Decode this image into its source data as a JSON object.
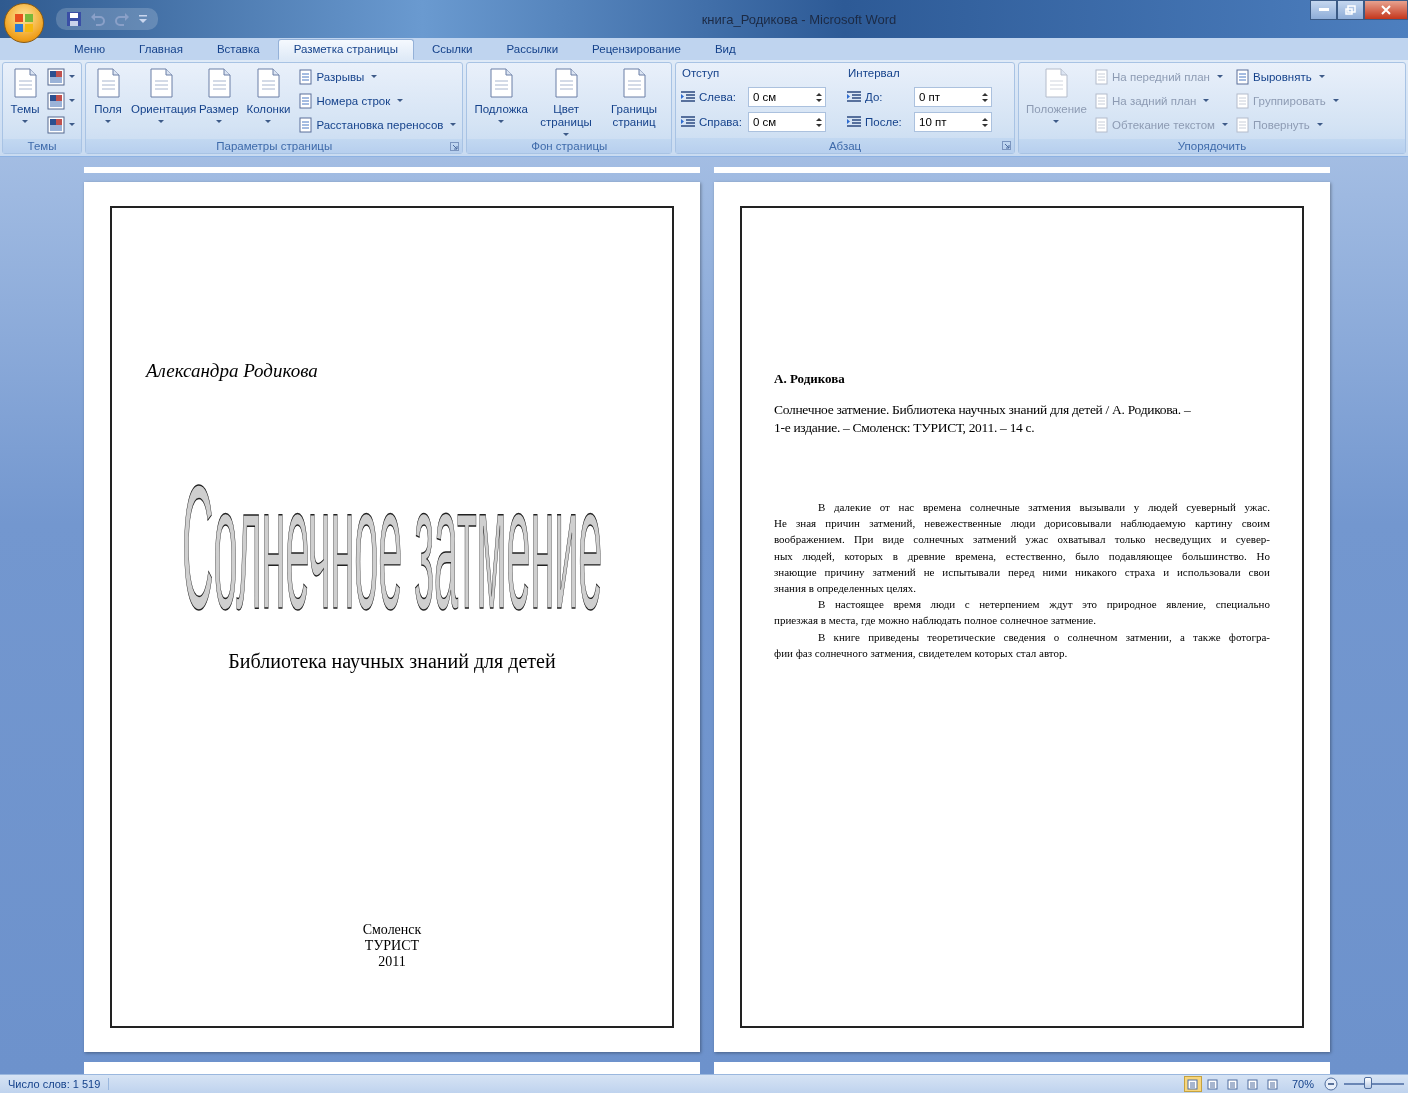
{
  "window": {
    "title": "книга_Родикова - Microsoft Word"
  },
  "tabs": [
    {
      "label": "Меню",
      "selected": false
    },
    {
      "label": "Главная",
      "selected": false
    },
    {
      "label": "Вставка",
      "selected": false
    },
    {
      "label": "Разметка страницы",
      "selected": true
    },
    {
      "label": "Ссылки",
      "selected": false
    },
    {
      "label": "Рассылки",
      "selected": false
    },
    {
      "label": "Рецензирование",
      "selected": false
    },
    {
      "label": "Вид",
      "selected": false
    }
  ],
  "ribbon": [
    {
      "label": "Темы",
      "launcher": false,
      "columns": [
        [
          {
            "kind": "large",
            "label": "Темы",
            "dropdown": true,
            "disabled": false
          }
        ],
        [
          {
            "kind": "icon",
            "dropdown": true,
            "disabled": false
          },
          {
            "kind": "icon",
            "dropdown": true,
            "disabled": false
          },
          {
            "kind": "icon",
            "dropdown": true,
            "disabled": false
          }
        ]
      ]
    },
    {
      "label": "Параметры страницы",
      "launcher": true,
      "columns": [
        [
          {
            "kind": "large",
            "label": "Поля",
            "dropdown": true,
            "disabled": false
          }
        ],
        [
          {
            "kind": "large",
            "label": "Ориентация",
            "dropdown": true,
            "disabled": false
          }
        ],
        [
          {
            "kind": "large",
            "label": "Размер",
            "dropdown": true,
            "disabled": false
          }
        ],
        [
          {
            "kind": "large",
            "label": "Колонки",
            "dropdown": true,
            "disabled": false
          }
        ],
        [
          {
            "kind": "small",
            "label": "Разрывы",
            "dropdown": true,
            "disabled": false
          },
          {
            "kind": "small",
            "label": "Номера строк",
            "dropdown": true,
            "disabled": false
          },
          {
            "kind": "small",
            "label": "Расстановка переносов",
            "dropdown": true,
            "disabled": false
          }
        ]
      ]
    },
    {
      "label": "Фон страницы",
      "launcher": false,
      "columns": [
        [
          {
            "kind": "large",
            "label": "Подложка",
            "dropdown": true,
            "disabled": false
          }
        ],
        [
          {
            "kind": "large",
            "label": "Цвет страницы",
            "dropdown": true,
            "disabled": false
          }
        ],
        [
          {
            "kind": "large",
            "label": "Границы страниц",
            "dropdown": false,
            "disabled": false
          }
        ]
      ]
    },
    {
      "label": "Абзац",
      "launcher": true,
      "columns": [
        [
          {
            "kind": "heading",
            "label": "Отступ"
          },
          {
            "kind": "spin",
            "label": "Слева:",
            "value": "0 см"
          },
          {
            "kind": "spin",
            "label": "Справа:",
            "value": "0 см"
          }
        ],
        [
          {
            "kind": "heading",
            "label": "Интервал"
          },
          {
            "kind": "spin",
            "label": "До:",
            "value": "0 пт"
          },
          {
            "kind": "spin",
            "label": "После:",
            "value": "10 пт"
          }
        ]
      ]
    },
    {
      "label": "Упорядочить",
      "launcher": false,
      "columns": [
        [
          {
            "kind": "large",
            "label": "Положение",
            "dropdown": true,
            "disabled": true
          }
        ],
        [
          {
            "kind": "small",
            "label": "На передний план",
            "dropdown": true,
            "disabled": true
          },
          {
            "kind": "small",
            "label": "На задний план",
            "dropdown": true,
            "disabled": true
          },
          {
            "kind": "small",
            "label": "Обтекание текстом",
            "dropdown": true,
            "disabled": true
          }
        ],
        [
          {
            "kind": "small",
            "label": "Выровнять",
            "dropdown": true,
            "disabled": false
          },
          {
            "kind": "small",
            "label": "Группировать",
            "dropdown": true,
            "disabled": true
          },
          {
            "kind": "small",
            "label": "Повернуть",
            "dropdown": true,
            "disabled": true
          }
        ]
      ]
    }
  ],
  "document": {
    "cover": {
      "author": "Александра Родикова",
      "title": "Солнечное затмение",
      "subtitle": "Библиотека научных знаний для детей",
      "imprint": [
        "Смоленск",
        "ТУРИСТ",
        "2011"
      ]
    },
    "verso": {
      "author": "А. Родикова",
      "bibliography": [
        "Солнечное затмение. Библиотека научных знаний для детей / А. Родикова. –",
        "1-е издание. – Смоленск: ТУРИСТ, 2011. – 14 с."
      ],
      "paragraphs": [
        [
          "В далекие от нас времена солнечные затмения вызывали у людей суеверный ужас.",
          "Не зная причин затмений, невежественные люди дорисовывали наблюдаемую картину своим",
          "воображением. При виде солнечных затмений ужас охватывал только несведущих и суевер-",
          "ных людей, которых в древние времена, естественно, было подавляющее большинство. Но",
          "знающие причину затмений не испытывали перед ними никакого страха и использовали свои",
          "знания в определенных целях."
        ],
        [
          "В настоящее время люди с нетерпением ждут это природное явление, специально",
          "приезжая в места, где можно наблюдать полное солнечное затмение."
        ],
        [
          "В книге приведены теоретические сведения о солнечном затмении, а также фотогра-",
          "фии фаз солнечного затмения, свидетелем которых стал автор."
        ]
      ]
    }
  },
  "status_bar": {
    "word_count": "Число слов: 1 519",
    "view_buttons": [
      {
        "selected": true
      },
      {
        "selected": false
      },
      {
        "selected": false
      },
      {
        "selected": false
      },
      {
        "selected": false
      }
    ],
    "zoom": "70%",
    "zoom_slider": {
      "level": 0.4
    }
  }
}
